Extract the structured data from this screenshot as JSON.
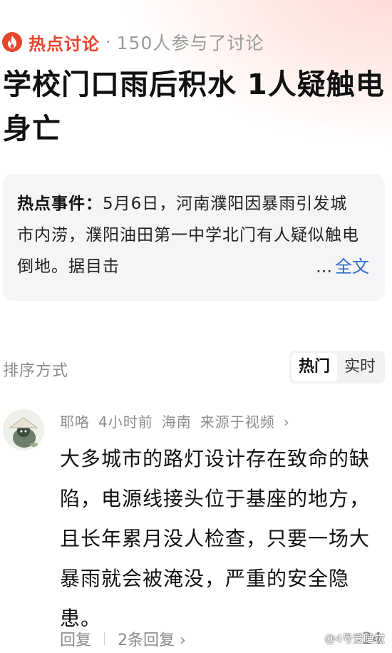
{
  "header": {
    "flame_icon": "flame-icon",
    "accent_color": "#e8452d",
    "hot_label": "热点讨论",
    "separator": "·",
    "participants": "150人参与了讨论"
  },
  "headline": "学校门口雨后积水 1人疑触电身亡",
  "summary": {
    "label": "热点事件：",
    "text": "5月6日，河南濮阳因暴雨引发城市内涝，濮阳油田第一中学北门有人疑似触电倒地。据目击",
    "ellipsis": "...",
    "full_text_link": "全文",
    "link_color": "#2f6fcf"
  },
  "sort": {
    "label": "排序方式",
    "options": [
      "热门",
      "实时"
    ],
    "selected": "热门"
  },
  "comment": {
    "author": "耶咯",
    "time": "4小时前",
    "location": "海南",
    "source": "来源于视频",
    "chevron": "›",
    "body": "大多城市的路灯设计存在致命的缺陷，电源线接头位于基座的地方，且长年累月没人检查，只要一场大暴雨就会被淹没，严重的安全隐患。",
    "reply_label": "回复",
    "replies_link": "2条回复",
    "like_count": "24"
  },
  "watermark": "@4号爱睡觉"
}
